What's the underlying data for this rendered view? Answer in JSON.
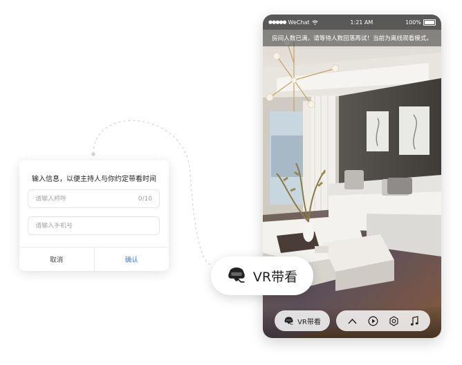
{
  "phone": {
    "status_bar": {
      "carrier": "WeChat",
      "time": "1:21 AM",
      "battery": "100%"
    },
    "notice": "房间人数已满，请等待人数回落再试！当前为离线观看模式。",
    "bottom_bar": {
      "vr_button_label": "VR带看",
      "controls": [
        "chevron-up-icon",
        "play-icon",
        "settings-icon",
        "music-icon"
      ]
    }
  },
  "vr_float_button": {
    "label": "VR带看",
    "icon": "vr-headset-icon"
  },
  "dialog": {
    "title": "输入信息，以便主持人与你约定带看时间",
    "name_field": {
      "placeholder": "请输入称呼",
      "value": "",
      "counter": "0/10"
    },
    "phone_field": {
      "placeholder": "请输入手机号",
      "value": ""
    },
    "cancel_label": "取消",
    "confirm_label": "确认"
  },
  "colors": {
    "accent": "#2f7ef3",
    "dialog_bg": "#ffffff"
  }
}
